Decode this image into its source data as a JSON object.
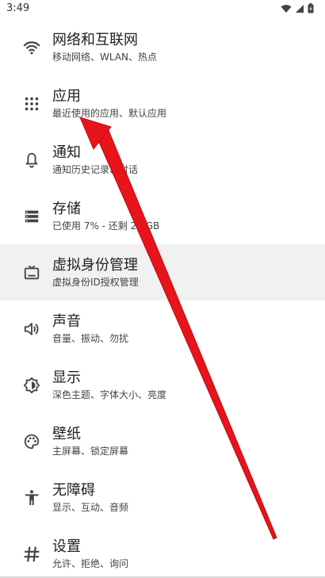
{
  "status_bar": {
    "time": "3:49"
  },
  "settings": [
    {
      "title": "网络和互联网",
      "subtitle": "移动网络、WLAN、热点",
      "icon": "wifi-icon"
    },
    {
      "title": "应用",
      "subtitle": "最近使用的应用、默认应用",
      "icon": "apps-grid-icon"
    },
    {
      "title": "通知",
      "subtitle": "通知历史记录、对话",
      "icon": "bell-icon"
    },
    {
      "title": "存储",
      "subtitle": "已使用 7% - 还剩 27 GB",
      "icon": "storage-icon"
    },
    {
      "title": "虚拟身份管理",
      "subtitle": "虚拟身份ID授权管理",
      "icon": "tv-icon"
    },
    {
      "title": "声音",
      "subtitle": "音量、振动、勿扰",
      "icon": "volume-icon"
    },
    {
      "title": "显示",
      "subtitle": "深色主题、字体大小、亮度",
      "icon": "brightness-icon"
    },
    {
      "title": "壁纸",
      "subtitle": "主屏幕、锁定屏幕",
      "icon": "palette-icon"
    },
    {
      "title": "无障碍",
      "subtitle": "显示、互动、音频",
      "icon": "accessibility-icon"
    },
    {
      "title": "设置",
      "subtitle": "允许、拒绝、询问",
      "icon": "hash-icon"
    }
  ],
  "colors": {
    "arrow": "#e8141b",
    "highlight": "#f1f1f1",
    "icon": "#444444"
  }
}
